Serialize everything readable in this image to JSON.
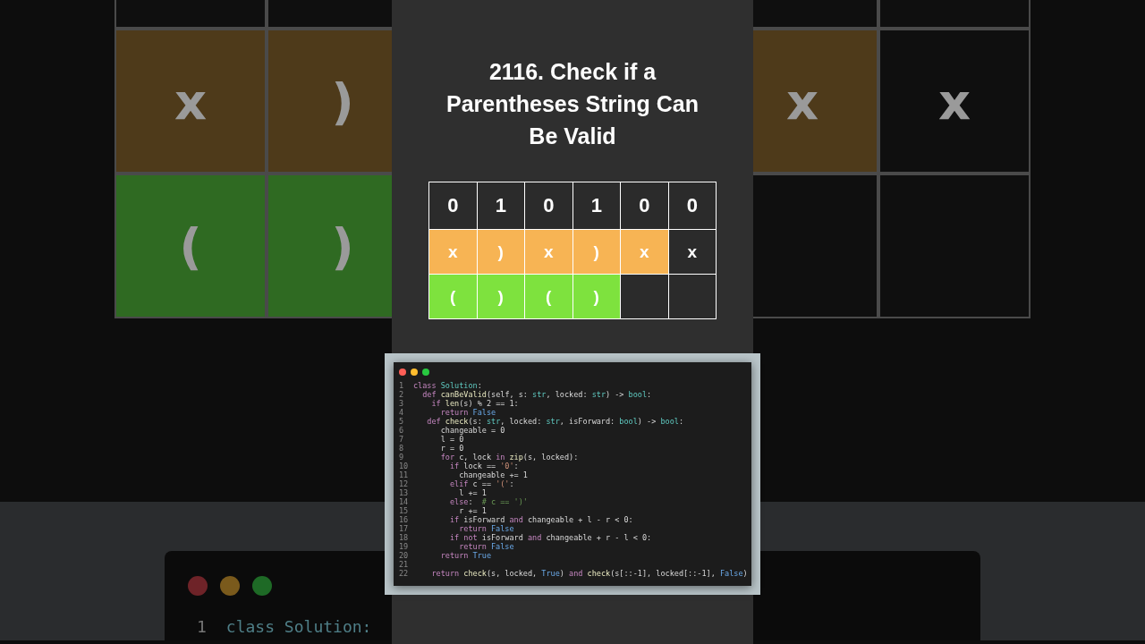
{
  "backdrop": {
    "left_grid": {
      "rows": [
        [
          {
            "color": "#0f0f0f"
          },
          {
            "color": "#0f0f0f"
          }
        ],
        [
          {
            "text": "x",
            "color": "#4e3a1a"
          },
          {
            "text": ")",
            "color": "#4e3a1a"
          }
        ],
        [
          {
            "text": "(",
            "color": "#2f6a22"
          },
          {
            "text": ")",
            "color": "#2f6a22"
          }
        ]
      ]
    },
    "right_grid": {
      "rows": [
        [
          {
            "color": "#0f0f0f"
          },
          {
            "color": "#0f0f0f"
          }
        ],
        [
          {
            "text": "x",
            "color": "#4e3a1a"
          },
          {
            "text": "x",
            "color": "#0f0f0f"
          }
        ],
        [
          {
            "color": "#0f0f0f"
          },
          {
            "color": "#0f0f0f"
          }
        ]
      ]
    },
    "code_peek": {
      "number": "1",
      "text": "class Solution:"
    }
  },
  "title": "2116. Check if a Parentheses String Can Be Valid",
  "table": {
    "rows": [
      [
        {
          "text": "0",
          "color": "#2b2b2b"
        },
        {
          "text": "1",
          "color": "#2b2b2b"
        },
        {
          "text": "0",
          "color": "#2b2b2b"
        },
        {
          "text": "1",
          "color": "#2b2b2b"
        },
        {
          "text": "0",
          "color": "#2b2b2b"
        },
        {
          "text": "0",
          "color": "#2b2b2b"
        }
      ],
      [
        {
          "text": "x",
          "color": "#f7b454"
        },
        {
          "text": ")",
          "color": "#f7b454"
        },
        {
          "text": "x",
          "color": "#f7b454"
        },
        {
          "text": ")",
          "color": "#f7b454"
        },
        {
          "text": "x",
          "color": "#f7b454"
        },
        {
          "text": "x",
          "color": "#2b2b2b"
        }
      ],
      [
        {
          "text": "(",
          "color": "#7ee23e"
        },
        {
          "text": ")",
          "color": "#7ee23e"
        },
        {
          "text": "(",
          "color": "#7ee23e"
        },
        {
          "text": ")",
          "color": "#7ee23e"
        },
        {
          "color": "#2b2b2b"
        },
        {
          "color": "#2b2b2b"
        }
      ]
    ]
  },
  "code": {
    "lines": [
      {
        "number": "1",
        "tokens": [
          {
            "kind": "keyword",
            "t": "class "
          },
          {
            "kind": "type",
            "t": "Solution"
          },
          {
            "kind": "plain",
            "t": ":"
          }
        ]
      },
      {
        "number": "2",
        "tokens": [
          {
            "kind": "keyword",
            "t": "  def "
          },
          {
            "kind": "function",
            "t": "canBeValid"
          },
          {
            "kind": "plain",
            "t": "(self, s: "
          },
          {
            "kind": "type",
            "t": "str"
          },
          {
            "kind": "plain",
            "t": ", locked: "
          },
          {
            "kind": "type",
            "t": "str"
          },
          {
            "kind": "plain",
            "t": ") -> "
          },
          {
            "kind": "type",
            "t": "bool"
          },
          {
            "kind": "plain",
            "t": ":"
          }
        ]
      },
      {
        "number": "3",
        "tokens": [
          {
            "kind": "keyword",
            "t": "    if "
          },
          {
            "kind": "function",
            "t": "len"
          },
          {
            "kind": "plain",
            "t": "(s) % 2 == 1:"
          }
        ]
      },
      {
        "number": "4",
        "tokens": [
          {
            "kind": "keyword",
            "t": "      return "
          },
          {
            "kind": "constant",
            "t": "False"
          }
        ]
      },
      {
        "number": "5",
        "tokens": [
          {
            "kind": "keyword",
            "t": "   def "
          },
          {
            "kind": "function",
            "t": "check"
          },
          {
            "kind": "plain",
            "t": "(s: "
          },
          {
            "kind": "type",
            "t": "str"
          },
          {
            "kind": "plain",
            "t": ", locked: "
          },
          {
            "kind": "type",
            "t": "str"
          },
          {
            "kind": "plain",
            "t": ", isForward: "
          },
          {
            "kind": "type",
            "t": "bool"
          },
          {
            "kind": "plain",
            "t": ") -> "
          },
          {
            "kind": "type",
            "t": "bool"
          },
          {
            "kind": "plain",
            "t": ":"
          }
        ]
      },
      {
        "number": "6",
        "tokens": [
          {
            "kind": "plain",
            "t": "      changeable = 0"
          }
        ]
      },
      {
        "number": "7",
        "tokens": [
          {
            "kind": "plain",
            "t": "      l = 0"
          }
        ]
      },
      {
        "number": "8",
        "tokens": [
          {
            "kind": "plain",
            "t": "      r = 0"
          }
        ]
      },
      {
        "number": "9",
        "tokens": [
          {
            "kind": "keyword",
            "t": "      for "
          },
          {
            "kind": "plain",
            "t": "c, lock "
          },
          {
            "kind": "keyword",
            "t": "in "
          },
          {
            "kind": "function",
            "t": "zip"
          },
          {
            "kind": "plain",
            "t": "(s, locked):"
          }
        ]
      },
      {
        "number": "10",
        "tokens": [
          {
            "kind": "keyword",
            "t": "        if "
          },
          {
            "kind": "plain",
            "t": "lock == "
          },
          {
            "kind": "string",
            "t": "'0'"
          },
          {
            "kind": "plain",
            "t": ":"
          }
        ]
      },
      {
        "number": "11",
        "tokens": [
          {
            "kind": "plain",
            "t": "          changeable += 1"
          }
        ]
      },
      {
        "number": "12",
        "tokens": [
          {
            "kind": "keyword",
            "t": "        elif "
          },
          {
            "kind": "plain",
            "t": "c == "
          },
          {
            "kind": "string",
            "t": "'('"
          },
          {
            "kind": "plain",
            "t": ":"
          }
        ]
      },
      {
        "number": "13",
        "tokens": [
          {
            "kind": "plain",
            "t": "          l += 1"
          }
        ]
      },
      {
        "number": "14",
        "tokens": [
          {
            "kind": "keyword",
            "t": "        else"
          },
          {
            "kind": "plain",
            "t": ":  "
          },
          {
            "kind": "comment",
            "t": "# c == ')'"
          }
        ]
      },
      {
        "number": "15",
        "tokens": [
          {
            "kind": "plain",
            "t": "          r += 1"
          }
        ]
      },
      {
        "number": "16",
        "tokens": [
          {
            "kind": "keyword",
            "t": "        if "
          },
          {
            "kind": "plain",
            "t": "isForward "
          },
          {
            "kind": "keyword",
            "t": "and "
          },
          {
            "kind": "plain",
            "t": "changeable + l - r < 0:"
          }
        ]
      },
      {
        "number": "17",
        "tokens": [
          {
            "kind": "keyword",
            "t": "          return "
          },
          {
            "kind": "constant",
            "t": "False"
          }
        ]
      },
      {
        "number": "18",
        "tokens": [
          {
            "kind": "keyword",
            "t": "        if not "
          },
          {
            "kind": "plain",
            "t": "isForward "
          },
          {
            "kind": "keyword",
            "t": "and "
          },
          {
            "kind": "plain",
            "t": "changeable + r - l < 0:"
          }
        ]
      },
      {
        "number": "19",
        "tokens": [
          {
            "kind": "keyword",
            "t": "          return "
          },
          {
            "kind": "constant",
            "t": "False"
          }
        ]
      },
      {
        "number": "20",
        "tokens": [
          {
            "kind": "keyword",
            "t": "      return "
          },
          {
            "kind": "constant",
            "t": "True"
          }
        ]
      },
      {
        "number": "21"
      },
      {
        "number": "22",
        "tokens": [
          {
            "kind": "keyword",
            "t": "    return "
          },
          {
            "kind": "function",
            "t": "check"
          },
          {
            "kind": "plain",
            "t": "(s, locked, "
          },
          {
            "kind": "constant",
            "t": "True"
          },
          {
            "kind": "plain",
            "t": ") "
          },
          {
            "kind": "keyword",
            "t": "and "
          },
          {
            "kind": "function",
            "t": "check"
          },
          {
            "kind": "plain",
            "t": "(s[::-1], locked[::-1], "
          },
          {
            "kind": "constant",
            "t": "False"
          },
          {
            "kind": "plain",
            "t": ")"
          }
        ]
      }
    ]
  }
}
